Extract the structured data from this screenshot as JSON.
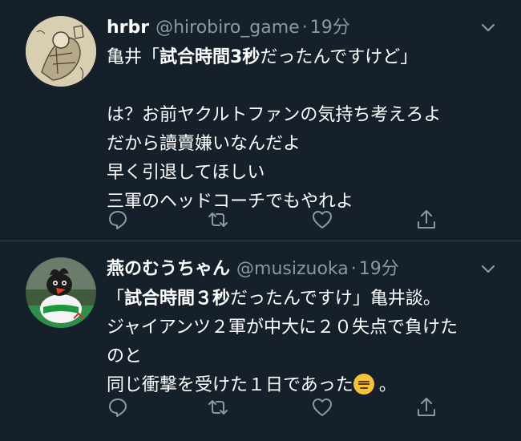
{
  "colors": {
    "background": "#15202b",
    "divider": "#38444d",
    "secondary_text": "#8899a6",
    "primary_text": "#ffffff"
  },
  "tweets": [
    {
      "name": "hrbr",
      "handle": "@hirobiro_game",
      "separator": "·",
      "time": "19分",
      "lines": [
        {
          "pre": "亀井「",
          "bold": "試合時間3秒",
          "post": "だったんですけど」"
        },
        {
          "pre": "",
          "bold": "",
          "post": ""
        },
        {
          "pre": "は？お前ヤクルトファンの気持ち考えろよ",
          "bold": "",
          "post": ""
        },
        {
          "pre": "だから讀賣嫌いなんだよ",
          "bold": "",
          "post": ""
        },
        {
          "pre": "早く引退してほしい",
          "bold": "",
          "post": ""
        },
        {
          "pre": "三軍のヘッドコーチでもやれよ",
          "bold": "",
          "post": ""
        }
      ],
      "icons": [
        "reply-icon",
        "retweet-icon",
        "like-icon",
        "share-icon"
      ]
    },
    {
      "name": "燕のむうちゃん",
      "handle": "@musizuoka",
      "separator": "·",
      "time": "19分",
      "lines": [
        {
          "pre": "「",
          "bold": "試合時間３秒",
          "post": "だったんですけ」亀井談。"
        },
        {
          "pre": "ジャイアンツ２軍が中大に２０失点で負けた",
          "bold": "",
          "post": ""
        },
        {
          "pre": "のと",
          "bold": "",
          "post": ""
        },
        {
          "pre": "同じ衝撃を受けた１日であった",
          "bold": "",
          "post": "。"
        }
      ],
      "emoji": "expressionless-face-icon",
      "icons": [
        "reply-icon",
        "retweet-icon",
        "like-icon",
        "share-icon"
      ]
    }
  ]
}
